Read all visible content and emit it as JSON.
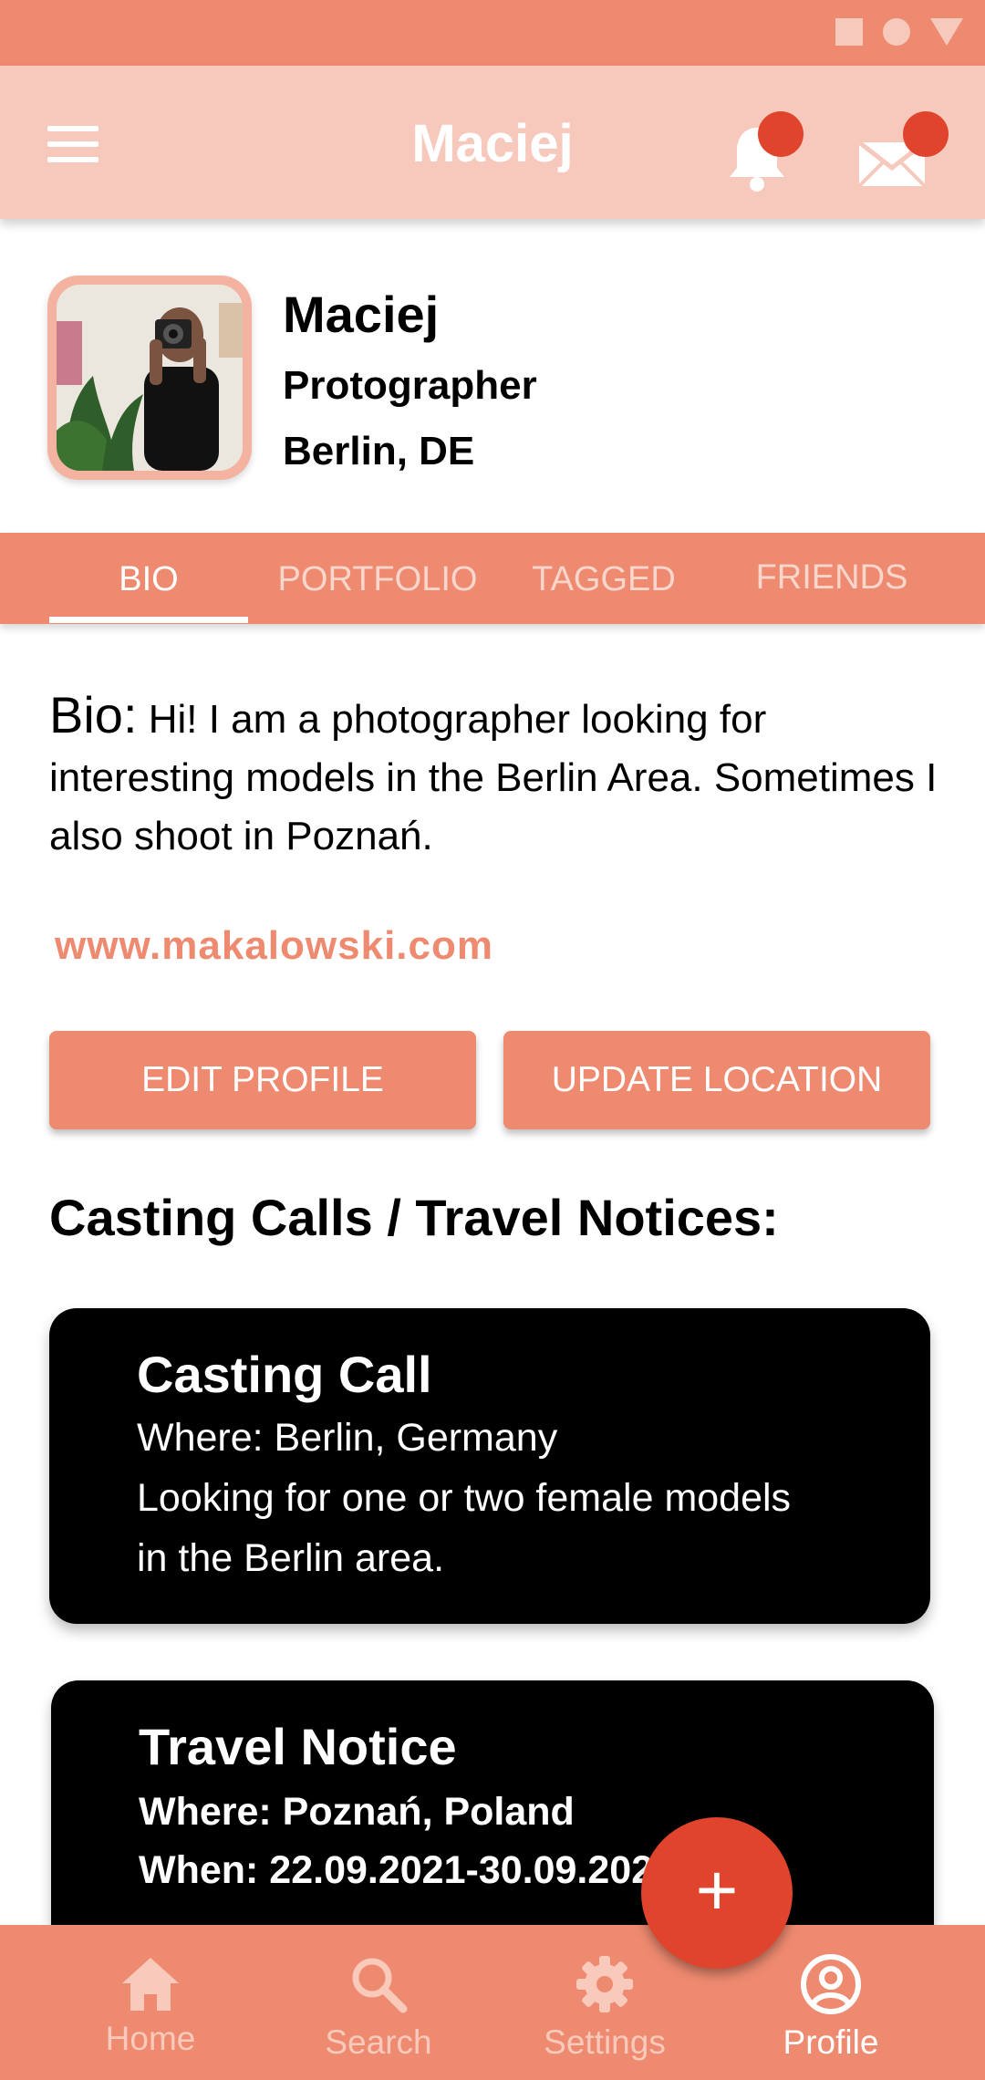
{
  "app_bar": {
    "title": "Maciej"
  },
  "profile": {
    "name": "Maciej",
    "role": "Protographer",
    "location": "Berlin, DE"
  },
  "tabs": [
    {
      "label": "BIO",
      "active": true
    },
    {
      "label": "PORTFOLIO",
      "active": false
    },
    {
      "label": "TAGGED",
      "active": false
    },
    {
      "label": "FRIENDS",
      "active": false
    }
  ],
  "bio": {
    "label": "Bio:",
    "text": "Hi! I am a photographer looking for interesting models in the Berlin Area. Sometimes I also shoot in Poznań.",
    "website": "www.makalowski.com"
  },
  "actions": {
    "edit_profile": "EDIT PROFILE",
    "update_location": "UPDATE LOCATION"
  },
  "section": {
    "title": "Casting Calls / Travel Notices:"
  },
  "cards": [
    {
      "title": "Casting Call",
      "lines": [
        "Where: Berlin, Germany",
        "Looking for one or two female models",
        "in the Berlin area."
      ]
    },
    {
      "title": "Travel Notice",
      "lines": [
        "Where: Poznań, Poland",
        "When: 22.09.2021-30.09.2021"
      ]
    }
  ],
  "fab": {
    "label": "+"
  },
  "bottom_nav": [
    {
      "label": "Home",
      "icon": "home-icon",
      "active": false
    },
    {
      "label": "Search",
      "icon": "search-icon",
      "active": false
    },
    {
      "label": "Settings",
      "icon": "gear-icon",
      "active": false
    },
    {
      "label": "Profile",
      "icon": "account-circle-icon",
      "active": true
    }
  ],
  "colors": {
    "primary": "#ee8a70",
    "primary_light": "#f6c9bc",
    "accent": "#e0442c",
    "card_bg": "#000000"
  }
}
